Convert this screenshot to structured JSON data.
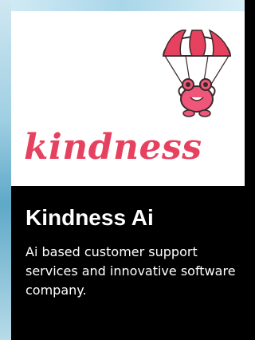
{
  "card": {
    "logo_text": "kindness",
    "logo_color": "#e6415f",
    "mascot_icon": "parachute-frog-icon",
    "title": "Kindness Ai",
    "description": "Ai based customer support services and innovative software company."
  }
}
